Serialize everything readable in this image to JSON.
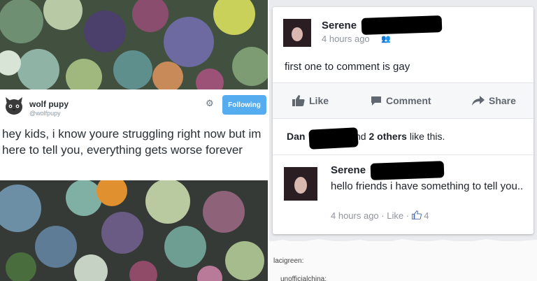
{
  "tweet": {
    "display_name": "wolf pupy",
    "handle": "@wolfpupy",
    "follow_label": "Following",
    "text": "hey kids, i know youre struggling right now but im here to tell you, everything gets worse forever"
  },
  "facebook": {
    "post_author": "Serene",
    "post_time": "4 hours ago",
    "post_text": "first one to comment is gay",
    "actions": {
      "like": "Like",
      "comment": "Comment",
      "share": "Share"
    },
    "likes_name": "Dan",
    "likes_rest": "and",
    "likes_others": "2 others",
    "likes_tail": "like this.",
    "comment": {
      "author": "Serene",
      "text": "hello friends i have something to tell you..",
      "time": "4 hours ago",
      "like_label": "Like",
      "like_count": "4"
    }
  },
  "tumblr": {
    "user1": "lacigreen:",
    "user2": "unofficialchina:"
  },
  "colors": {
    "twitter_blue": "#55acee",
    "fb_text": "#1d2129",
    "fb_meta": "#90949c"
  }
}
